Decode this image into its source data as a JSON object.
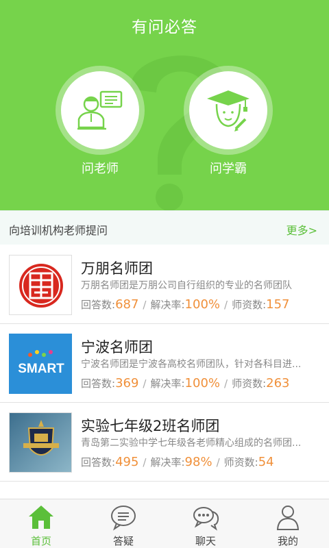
{
  "header": {
    "title": "有问必答"
  },
  "roles": [
    {
      "label": "问老师",
      "icon": "teacher-icon"
    },
    {
      "label": "问学霸",
      "icon": "student-icon"
    }
  ],
  "section": {
    "title": "向培训机构老师提问",
    "more": "更多>"
  },
  "stat_labels": {
    "answers": "回答数:",
    "solve_rate": "解决率:",
    "teachers": "师资数:",
    "separator": "/"
  },
  "groups": [
    {
      "name": "万朋名师团",
      "desc": "万朋名师团是万朋公司自行组织的专业的名师团队",
      "answers": "687",
      "solve_rate": "100%",
      "teachers": "157",
      "logo": "wanpeng-seal-logo"
    },
    {
      "name": "宁波名师团",
      "desc": "宁波名师团是宁波各高校名师团队，针对各科目进...",
      "answers": "369",
      "solve_rate": "100%",
      "teachers": "263",
      "logo": "smart-logo",
      "logo_text": "SMART"
    },
    {
      "name": "实验七年级2班名师团",
      "desc": "青岛第二实验中学七年级各老师精心组成的名师团...",
      "answers": "495",
      "solve_rate": "98%",
      "teachers": "54",
      "logo": "school-crest-logo"
    }
  ],
  "nav": [
    {
      "label": "首页",
      "icon": "home-icon",
      "active": true
    },
    {
      "label": "答疑",
      "icon": "chat-bubble-icon",
      "active": false
    },
    {
      "label": "聊天",
      "icon": "chat-dots-icon",
      "active": false
    },
    {
      "label": "我的",
      "icon": "person-icon",
      "active": false
    }
  ],
  "colors": {
    "primary_green": "#76d34b",
    "accent_orange": "#f0903a",
    "link_green": "#5bbf3a",
    "logo_red": "#d8281f",
    "logo_blue": "#2b8fd8"
  }
}
